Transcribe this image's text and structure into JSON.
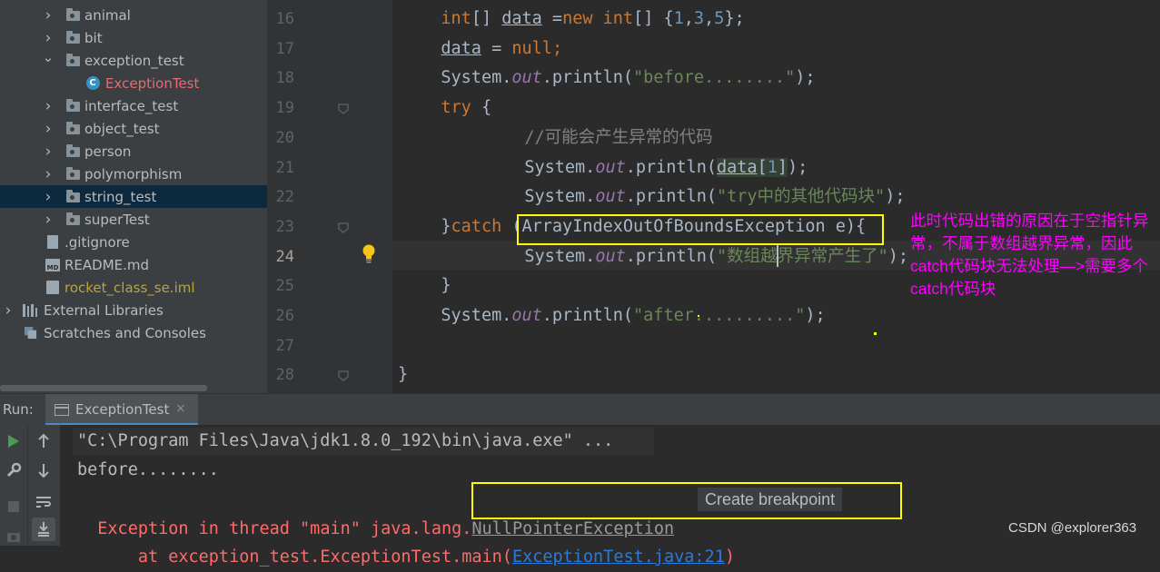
{
  "project_tree": {
    "items": [
      {
        "label": "animal",
        "type": "folder",
        "expanded": false
      },
      {
        "label": "bit",
        "type": "folder",
        "expanded": false
      },
      {
        "label": "exception_test",
        "type": "folder",
        "expanded": true
      },
      {
        "label": "ExceptionTest",
        "type": "class",
        "color": "#e06c75"
      },
      {
        "label": "interface_test",
        "type": "folder",
        "expanded": false
      },
      {
        "label": "object_test",
        "type": "folder",
        "expanded": false
      },
      {
        "label": "person",
        "type": "folder",
        "expanded": false
      },
      {
        "label": "polymorphism",
        "type": "folder",
        "expanded": false
      },
      {
        "label": "string_test",
        "type": "folder",
        "expanded": false,
        "selected": true
      },
      {
        "label": "superTest",
        "type": "folder",
        "expanded": false
      },
      {
        "label": ".gitignore",
        "type": "file"
      },
      {
        "label": "README.md",
        "type": "markdown"
      },
      {
        "label": "rocket_class_se.iml",
        "type": "iml",
        "color": "#b5a642"
      },
      {
        "label": "External Libraries",
        "type": "library",
        "expanded": false
      },
      {
        "label": "Scratches and Consoles",
        "type": "scratches"
      }
    ]
  },
  "editor": {
    "line_numbers": [
      "16",
      "17",
      "18",
      "19",
      "20",
      "21",
      "22",
      "23",
      "24",
      "25",
      "26",
      "27",
      "28"
    ],
    "current_line": "24",
    "lines": [
      {
        "tokens": [
          {
            "t": "int",
            "c": "kw"
          },
          {
            "t": "[] ",
            "c": ""
          },
          {
            "t": "data",
            "c": "uline"
          },
          {
            "t": " =",
            "c": ""
          },
          {
            "t": "new ",
            "c": "kw"
          },
          {
            "t": "int",
            "c": "kw"
          },
          {
            "t": "[] {",
            "c": ""
          },
          {
            "t": "1",
            "c": "num"
          },
          {
            "t": ",",
            "c": ""
          },
          {
            "t": "3",
            "c": "num"
          },
          {
            "t": ",",
            "c": ""
          },
          {
            "t": "5",
            "c": "num"
          },
          {
            "t": "};",
            "c": ""
          }
        ]
      },
      {
        "tokens": [
          {
            "t": "data",
            "c": "uline"
          },
          {
            "t": " = ",
            "c": ""
          },
          {
            "t": "null",
            "c": "kw"
          },
          {
            "t": ";",
            "c": "kw"
          }
        ]
      },
      {
        "tokens": [
          {
            "t": "System.",
            "c": ""
          },
          {
            "t": "out",
            "c": "fld"
          },
          {
            "t": ".println(",
            "c": ""
          },
          {
            "t": "\"before........\"",
            "c": "str"
          },
          {
            "t": ");",
            "c": ""
          }
        ]
      },
      {
        "tokens": [
          {
            "t": "try",
            "c": "kw"
          },
          {
            "t": " {",
            "c": ""
          }
        ]
      },
      {
        "tokens": [
          {
            "t": "    //可能会产生异常的代码",
            "c": "cm"
          }
        ]
      },
      {
        "tokens": [
          {
            "t": "    System.",
            "c": ""
          },
          {
            "t": "out",
            "c": "fld"
          },
          {
            "t": ".println(",
            "c": ""
          },
          {
            "t": "data",
            "c": "hl uline"
          },
          {
            "t": "[",
            "c": "hl"
          },
          {
            "t": "1",
            "c": "hl num"
          },
          {
            "t": "]",
            "c": "hl"
          },
          {
            "t": ");",
            "c": ""
          }
        ]
      },
      {
        "tokens": [
          {
            "t": "    System.",
            "c": ""
          },
          {
            "t": "out",
            "c": "fld"
          },
          {
            "t": ".println(",
            "c": ""
          },
          {
            "t": "\"try中的其他代码块\"",
            "c": "str"
          },
          {
            "t": ");",
            "c": ""
          }
        ]
      },
      {
        "tokens": [
          {
            "t": "}",
            "c": ""
          },
          {
            "t": "catch",
            "c": "kw"
          },
          {
            "t": " (ArrayIndexOutOfBoundsException e){",
            "c": ""
          }
        ]
      },
      {
        "tokens": [
          {
            "t": "    System.",
            "c": ""
          },
          {
            "t": "out",
            "c": "fld"
          },
          {
            "t": ".println(",
            "c": ""
          },
          {
            "t": "\"数组越界异常产生了\"",
            "c": "str"
          },
          {
            "t": ");",
            "c": ""
          }
        ]
      },
      {
        "tokens": [
          {
            "t": "}",
            "c": ""
          }
        ]
      },
      {
        "tokens": [
          {
            "t": "System.",
            "c": ""
          },
          {
            "t": "out",
            "c": "fld"
          },
          {
            "t": ".println(",
            "c": ""
          },
          {
            "t": "\"after..........\"",
            "c": "str"
          },
          {
            "t": ");",
            "c": ""
          }
        ]
      },
      {
        "tokens": []
      },
      {
        "tokens": [
          {
            "t": "}",
            "c": ""
          }
        ]
      }
    ],
    "indents": [
      1,
      1,
      1,
      1,
      2,
      2,
      2,
      1,
      2,
      1,
      1,
      0,
      0
    ]
  },
  "annotation": {
    "text": "此时代码出错的原因在于空指针异常，不属于数组越界异常，因此catch代码块无法处理—>需要多个catch代码块",
    "color": "#ff00ff"
  },
  "run_panel": {
    "label": "Run:",
    "tab_label": "ExceptionTest",
    "tab_close": "×",
    "console": {
      "path_line": "\"C:\\Program Files\\Java\\jdk1.8.0_192\\bin\\java.exe\" ...",
      "before_line": "before........",
      "exception_prefix": "Exception in thread \"main\" java.lang.",
      "exception_name": "NullPointerException",
      "tooltip": "Create breakpoint",
      "at_prefix": "    at exception_test.ExceptionTest.main(",
      "at_link": "ExceptionTest.java:21",
      "at_suffix": ")"
    }
  },
  "watermark": "CSDN @explorer363",
  "colors": {
    "keyword": "#cc7832",
    "string": "#6a8759",
    "field": "#9876aa",
    "number": "#6897bb",
    "highlight_box": "#ffff00",
    "error_text": "#ff6b68",
    "link": "#287bde"
  }
}
